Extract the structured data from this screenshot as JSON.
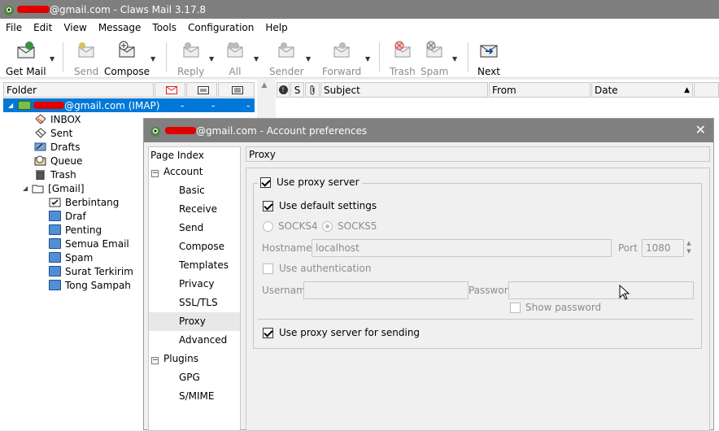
{
  "window": {
    "title": "@gmail.com - Claws Mail 3.17.8"
  },
  "menu": [
    "File",
    "Edit",
    "View",
    "Message",
    "Tools",
    "Configuration",
    "Help"
  ],
  "toolbar": {
    "get_mail": "Get Mail",
    "send": "Send",
    "compose": "Compose",
    "reply": "Reply",
    "all": "All",
    "sender": "Sender",
    "forward": "Forward",
    "trash": "Trash",
    "spam": "Spam",
    "next": "Next"
  },
  "folder_pane": {
    "header": "Folder",
    "account": {
      "label": "@gmail.com (IMAP)",
      "c1": "-",
      "c2": "-",
      "c3": "-"
    },
    "folders": [
      {
        "label": "INBOX",
        "icon": "inbox-icon"
      },
      {
        "label": "Sent",
        "icon": "sent-icon"
      },
      {
        "label": "Drafts",
        "icon": "drafts-icon"
      },
      {
        "label": "Queue",
        "icon": "queue-icon"
      },
      {
        "label": "Trash",
        "icon": "trash-icon"
      },
      {
        "label": "[Gmail]",
        "icon": "folder-open-icon"
      }
    ],
    "gmail_folders": [
      {
        "label": "Berbintang"
      },
      {
        "label": "Draf"
      },
      {
        "label": "Penting"
      },
      {
        "label": "Semua Email"
      },
      {
        "label": "Spam"
      },
      {
        "label": "Surat Terkirim"
      },
      {
        "label": "Tong Sampah"
      }
    ]
  },
  "message_list": {
    "columns": {
      "flag": "!",
      "status": "S",
      "subject": "Subject",
      "from": "From",
      "date": "Date"
    }
  },
  "dialog": {
    "title": "@gmail.com - Account preferences",
    "page_index_header": "Page Index",
    "account_group": "Account",
    "account_pages": [
      "Basic",
      "Receive",
      "Send",
      "Compose",
      "Templates",
      "Privacy",
      "SSL/TLS",
      "Proxy",
      "Advanced"
    ],
    "plugins_group": "Plugins",
    "plugin_pages": [
      "GPG",
      "S/MIME"
    ],
    "selected_page": "Proxy",
    "page_title": "Proxy",
    "use_proxy_server": "Use proxy server",
    "use_default_settings": "Use default settings",
    "socks4": "SOCKS4",
    "socks5": "SOCKS5",
    "hostname_label": "Hostname",
    "hostname_value": "localhost",
    "port_label": "Port",
    "port_value": "1080",
    "use_authentication": "Use authentication",
    "username_label": "Username",
    "username_value": "",
    "password_label": "Password",
    "password_value": "",
    "show_password": "Show password",
    "use_proxy_for_sending": "Use proxy server for sending"
  },
  "colors": {
    "selection": "#0078d7",
    "title_bar": "#7f7f7f",
    "redaction": "#e00000"
  }
}
